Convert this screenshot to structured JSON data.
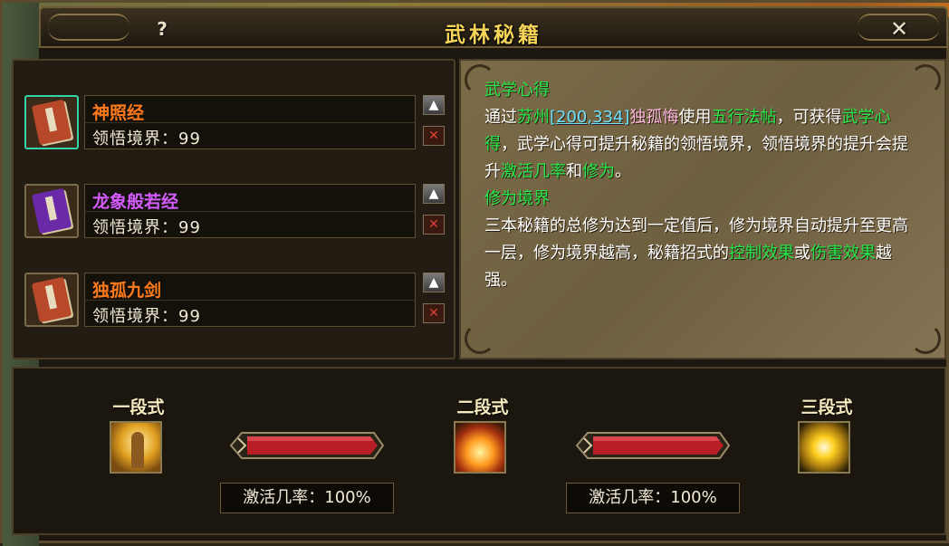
{
  "window": {
    "title": "武林秘籍",
    "help_glyph": "?",
    "close_glyph": "✕"
  },
  "books": [
    {
      "name": "神照经",
      "level_text": "领悟境界：99",
      "name_color": "#ff7a1c",
      "cover_color": "#b8482a",
      "selected": true
    },
    {
      "name": "龙象般若经",
      "level_text": "领悟境界：99",
      "name_color": "#d45cff",
      "cover_color": "#6a2aa8",
      "selected": false
    },
    {
      "name": "独孤九剑",
      "level_text": "领悟境界：99",
      "name_color": "#ff7a1c",
      "cover_color": "#b8482a",
      "selected": false
    }
  ],
  "book_controls": {
    "up_glyph": "▲",
    "remove_glyph": "✕"
  },
  "description": {
    "heading1": "武学心得",
    "p1": {
      "t1": "通过",
      "place": "苏州",
      "coords": "[200,334]",
      "npc": "独孤悔",
      "t2": "使用",
      "item": "五行法帖",
      "t3": "，可获得",
      "term": "武学心得",
      "t4": "，武学心得可提升秘籍的领悟境界，领悟境界的提升会提升",
      "rate": "激活几率",
      "t5": "和",
      "cult": "修为",
      "t6": "。"
    },
    "heading2": "修为境界",
    "p2": {
      "t1": "三本秘籍的总修为达到一定值后，修为境界自动提升至更高一层，修为境界越高，秘籍招式的",
      "control": "控制效果",
      "t2": "或",
      "harm": "伤害效果",
      "t3": "越强。"
    }
  },
  "stages": [
    {
      "label": "一段式",
      "icon": "figure-glow-icon"
    },
    {
      "label": "二段式",
      "icon": "fire-burst-icon"
    },
    {
      "label": "三段式",
      "icon": "golden-orb-icon"
    }
  ],
  "rates": [
    "激活几率：100%",
    "激活几率：100%"
  ],
  "colors": {
    "title": "#f6d458",
    "highlight_green": "#27e84b",
    "link_cyan": "#6fe0ff",
    "npc_pink": "#ffb7e0",
    "arrow_red": "#c0202a"
  }
}
